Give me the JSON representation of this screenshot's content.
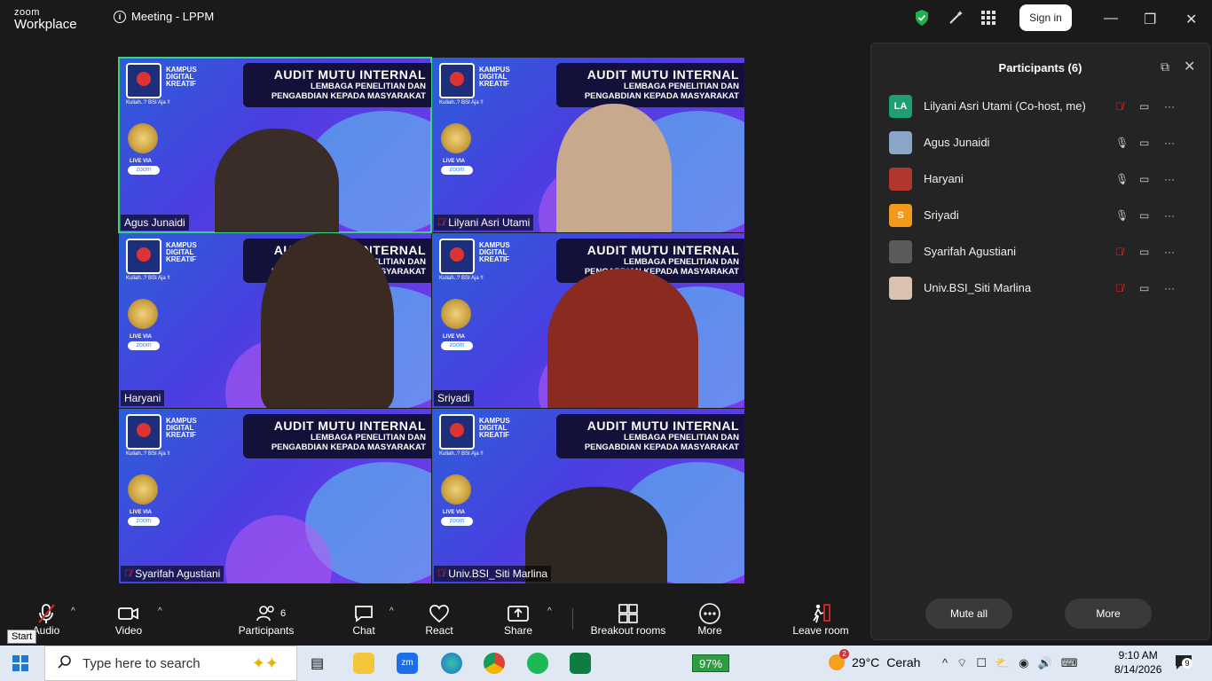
{
  "app": {
    "brand_top": "zoom",
    "brand_bottom": "Workplace",
    "meeting_title": "Meeting - LPPM",
    "sign_in": "Sign in"
  },
  "tile_banner": {
    "line1": "AUDIT MUTU INTERNAL",
    "line2": "LEMBAGA PENELITIAN DAN",
    "line3": "PENGABDIAN KEPADA MASYARAKAT",
    "kampus": "KAMPUS DIGITAL KREATIF",
    "tagline": "Kuliah..? BSI Aja !!",
    "live": "LIVE VIA",
    "zoom": "zoom"
  },
  "tiles": [
    {
      "name": "Agus Junaidi",
      "muted": false,
      "active": true
    },
    {
      "name": "Lilyani Asri Utami",
      "muted": true,
      "active": false
    },
    {
      "name": "Haryani",
      "muted": false,
      "active": false
    },
    {
      "name": "Sriyadi",
      "muted": false,
      "active": false
    },
    {
      "name": "Syarifah Agustiani",
      "muted": true,
      "active": false
    },
    {
      "name": "Univ.BSI_Siti Marlina",
      "muted": true,
      "active": false
    }
  ],
  "toolbar": {
    "audio": "Audio",
    "video": "Video",
    "participants": "Participants",
    "participants_count": "6",
    "chat": "Chat",
    "react": "React",
    "share": "Share",
    "breakout": "Breakout rooms",
    "more": "More",
    "leave": "Leave room",
    "start_tooltip": "Start"
  },
  "panel": {
    "title": "Participants (6)",
    "participants": [
      {
        "name": "Lilyani Asri Utami (Co-host, me)",
        "initials": "LA",
        "avatar_color": "#1f9e74",
        "muted": true
      },
      {
        "name": "Agus Junaidi",
        "initials": "",
        "avatar_color": "#8aa6c8",
        "muted": false
      },
      {
        "name": "Haryani",
        "initials": "",
        "avatar_color": "#b0362e",
        "muted": false
      },
      {
        "name": "Sriyadi",
        "initials": "S",
        "avatar_color": "#f39a1b",
        "muted": false
      },
      {
        "name": "Syarifah Agustiani",
        "initials": "",
        "avatar_color": "#5a5a5a",
        "muted": true
      },
      {
        "name": "Univ.BSI_Siti Marlina",
        "initials": "",
        "avatar_color": "#d9c3b0",
        "muted": true
      }
    ],
    "mute_all": "Mute all",
    "more": "More"
  },
  "taskbar": {
    "search_placeholder": "Type here to search",
    "battery": "97%",
    "weather_temp": "29°C",
    "weather_text": "Cerah",
    "weather_badge": "2",
    "time": "9:10 AM",
    "date": "8/14/2026",
    "notif_count": "9"
  }
}
